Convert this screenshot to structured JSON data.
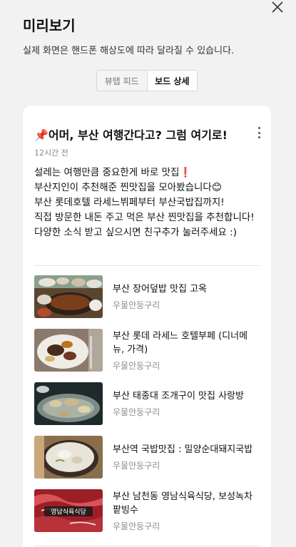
{
  "modal": {
    "title": "미리보기",
    "description": "실제 화면은 핸드폰 해상도에 따라 달라질 수 있습니다.",
    "tabs": [
      {
        "label": "뷰탭 피드",
        "active": false
      },
      {
        "label": "보드 상세",
        "active": true
      }
    ]
  },
  "post": {
    "title": "📌어머, 부산 여행간다고? 그럼 여기로!",
    "time": "12시간 전",
    "body": [
      "설레는 여행만큼 중요한게 바로 맛집❗",
      "부산지인이 추천해준 찐맛집을 모아봤습니다😊",
      "부산 롯데호텔 라세느뷔페부터 부산국밥집까지!",
      "직접 방문한 내돈 주고 먹은 부산 찐맛집을 추천합니다!",
      "다양한 소식 받고 싶으시면 친구추가 눌러주세요 :)"
    ],
    "items": [
      {
        "title": "부산 장어덮밥 맛집 고옥",
        "author": "우물안둥구리",
        "thumb": "eel-rice"
      },
      {
        "title": "부산 롯데 라세느 호텔부페 (디너메뉴, 가격)",
        "author": "우물안둥구리",
        "thumb": "buffet"
      },
      {
        "title": "부산 태종대 조개구이 맛집 사랑방",
        "author": "우물안둥구리",
        "thumb": "grilled-clams"
      },
      {
        "title": "부산역 국밥맛집 : 밀양순대돼지국밥",
        "author": "우물안둥구리",
        "thumb": "gukbap"
      },
      {
        "title": "부산 남천동 영남식육식당, 보성녹차 팥빙수",
        "author": "우물안둥구리",
        "thumb": "raw-beef",
        "thumb_caption": "영남식육식당"
      }
    ]
  },
  "colors": {
    "background": "#f2f2f2",
    "card": "#ffffff",
    "muted_text": "#8c8c8c"
  }
}
